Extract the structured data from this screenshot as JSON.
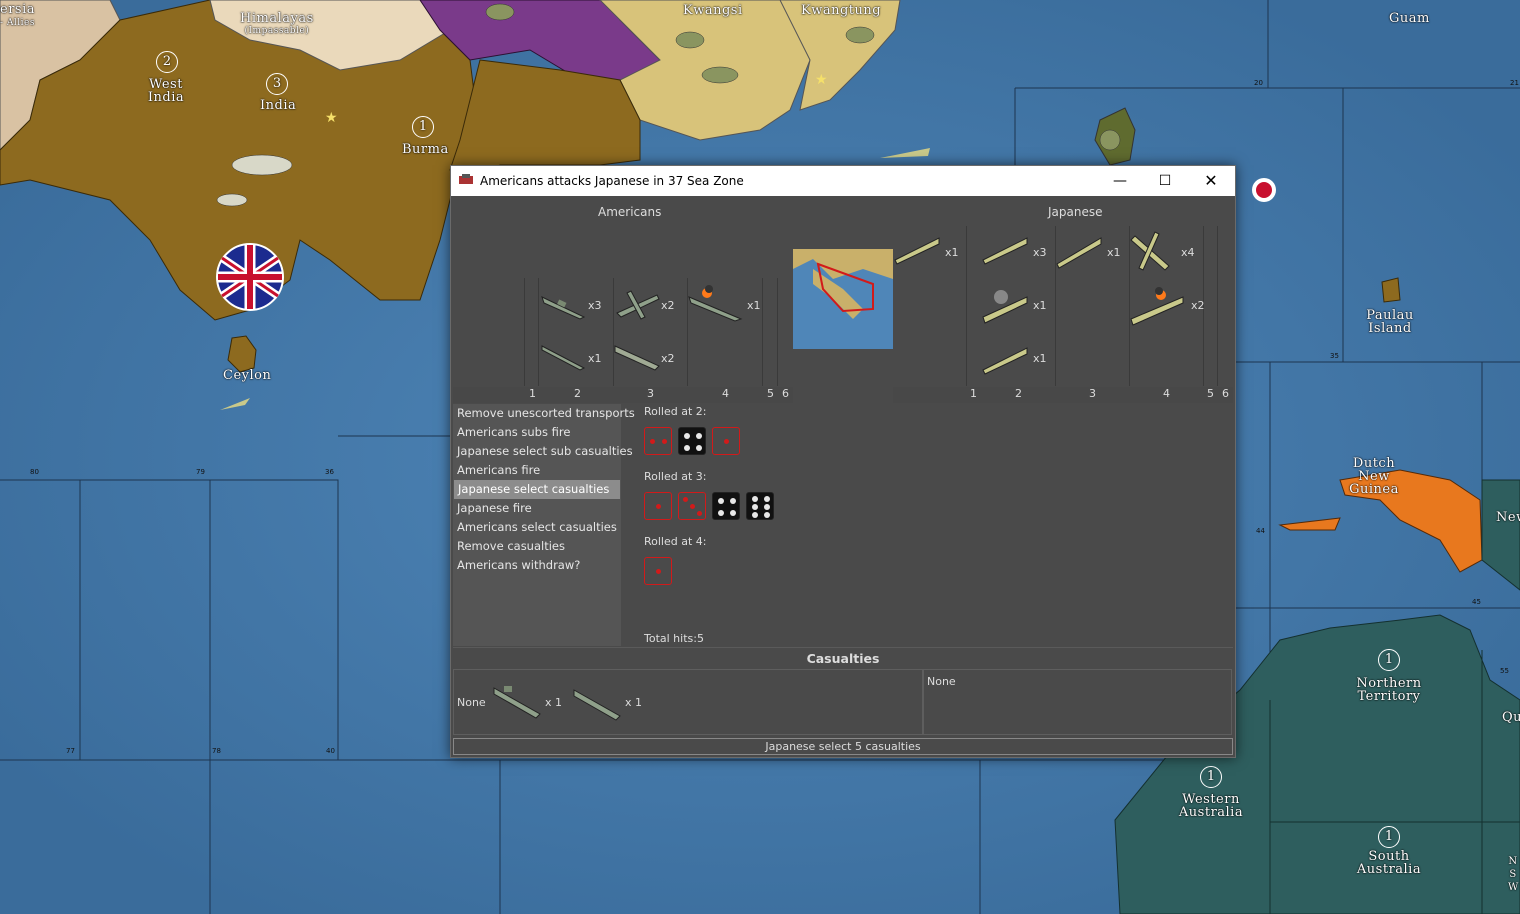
{
  "map": {
    "labels": {
      "persia": "ersia",
      "allies": "- Allies",
      "himalayas": "Himalayas",
      "impassable": "(Impassable)",
      "west_india": "West India",
      "india": "India",
      "burma": "Burma",
      "kwangsi": "Kwangsi",
      "kwangtung": "Kwangtung",
      "guam": "Guam",
      "ceylon": "Ceylon",
      "paulau": "Paulau Island",
      "dutch_new_guinea": "Dutch New Guinea",
      "new": "New",
      "northern_territory": "Northern Territory",
      "western_australia": "Western Australia",
      "south_australia": "South Australia",
      "qu": "Qu",
      "nsw": "N S W"
    },
    "circles": {
      "west_india": "2",
      "india": "3",
      "burma": "1",
      "northern_territory": "1",
      "western_australia": "1",
      "south_australia": "1"
    },
    "zone_numbers": [
      "80",
      "79",
      "36",
      "77",
      "78",
      "40",
      "20",
      "21",
      "35",
      "44",
      "45",
      "55"
    ]
  },
  "dialog": {
    "title": "Americans attacks Japanese in 37 Sea Zone",
    "attacker": "Americans",
    "defender": "Japanese",
    "attacker_units": [
      {
        "icon": "battleship-icon",
        "count": "x3"
      },
      {
        "icon": "fighter-icon",
        "count": "x2"
      },
      {
        "icon": "damaged-battleship-icon",
        "count": "x1"
      },
      {
        "icon": "submarine-icon",
        "count": "x1"
      },
      {
        "icon": "destroyer-icon",
        "count": "x2"
      },
      {
        "icon": "transport-icon",
        "count": "x1"
      }
    ],
    "defender_units": [
      {
        "icon": "battleship-icon",
        "count": "x3"
      },
      {
        "icon": "cruiser-icon",
        "count": "x1"
      },
      {
        "icon": "fighter-icon",
        "count": "x4"
      },
      {
        "icon": "damaged-carrier-icon",
        "count": "x1"
      },
      {
        "icon": "damaged-battleship-icon",
        "count": "x2"
      },
      {
        "icon": "submarine-icon",
        "count": "x1"
      }
    ],
    "column_numbers": [
      "1",
      "2",
      "3",
      "4",
      "5",
      "6"
    ],
    "steps": [
      "Remove unescorted transports",
      "Americans subs fire",
      "Japanese select sub casualties",
      "Americans fire",
      "Japanese select casualties",
      "Japanese fire",
      "Americans select casualties",
      "Remove casualties",
      "Americans withdraw?"
    ],
    "selected_step": 4,
    "rolls": [
      {
        "label": "Rolled at 2:",
        "dice": [
          2,
          4,
          1
        ],
        "hits": [
          true,
          false,
          true
        ]
      },
      {
        "label": "Rolled at 3:",
        "dice": [
          1,
          3,
          4,
          6
        ],
        "hits": [
          true,
          true,
          false,
          false
        ]
      },
      {
        "label": "Rolled at 4:",
        "dice": [
          1
        ],
        "hits": [
          true
        ]
      }
    ],
    "total_hits": "Total hits:5",
    "casualties_header": "Casualties",
    "casualties_left": {
      "none": "None",
      "items": [
        {
          "icon": "submarine-icon",
          "count": "x 1"
        },
        {
          "icon": "destroyer-icon",
          "count": "x 1"
        }
      ]
    },
    "casualties_right": {
      "none": "None"
    },
    "status": "Japanese select 5 casualties"
  },
  "colors": {
    "ocean": "#3f74a3",
    "india": "#8d6a1f",
    "china_purple": "#7a3a8a",
    "kwangsi": "#d8c37a",
    "australia": "#2e5e5e",
    "guinea": "#e8781e",
    "dialog_bg": "#4a4a4a",
    "hit": "#d21a1a"
  }
}
